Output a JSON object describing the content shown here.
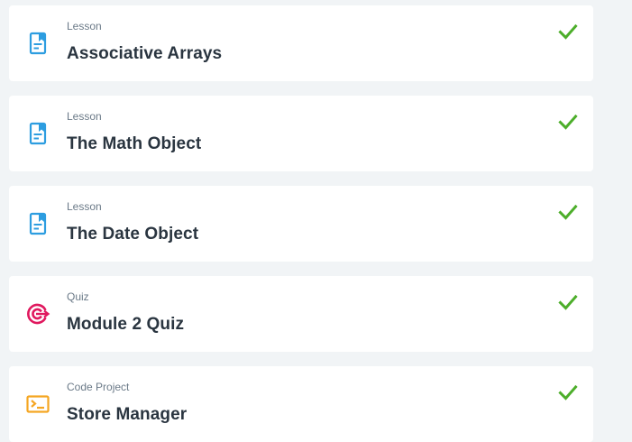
{
  "colors": {
    "lesson_icon": "#2d9de0",
    "quiz_icon": "#e0185e",
    "project_icon": "#f5a623",
    "check": "#4cae2a"
  },
  "items": [
    {
      "kind": "Lesson",
      "title": "Associative Arrays",
      "icon": "document-icon",
      "completed": true
    },
    {
      "kind": "Lesson",
      "title": "The Math Object",
      "icon": "document-icon",
      "completed": true
    },
    {
      "kind": "Lesson",
      "title": "The Date Object",
      "icon": "document-icon",
      "completed": true
    },
    {
      "kind": "Quiz",
      "title": "Module 2 Quiz",
      "icon": "target-icon",
      "completed": true
    },
    {
      "kind": "Code Project",
      "title": "Store Manager",
      "icon": "terminal-icon",
      "completed": true
    }
  ]
}
